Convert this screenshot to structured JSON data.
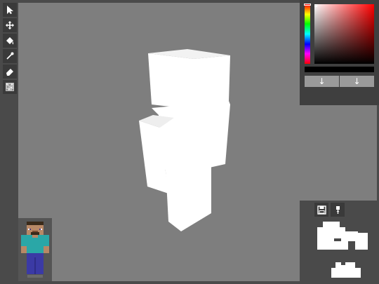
{
  "toolbar": {
    "tools": [
      {
        "name": "select",
        "icon": "cursor-arrow-icon"
      },
      {
        "name": "move",
        "icon": "move-arrows-icon"
      },
      {
        "name": "fill",
        "icon": "paint-bucket-icon"
      },
      {
        "name": "picker",
        "icon": "eyedropper-icon"
      },
      {
        "name": "eraser",
        "icon": "eraser-icon"
      },
      {
        "name": "noise",
        "icon": "noise-texture-icon"
      }
    ]
  },
  "color_picker": {
    "hue_color": "#ff0000",
    "current_color": "#000000",
    "swap_left_glyph": "↓",
    "swap_right_glyph": "↓"
  },
  "parts_panel": {
    "tabs": [
      {
        "name": "save",
        "icon": "save-disk-icon"
      },
      {
        "name": "export",
        "icon": "brush-upload-icon"
      }
    ]
  },
  "colors": {
    "background": "#4a4a4a",
    "viewport": "#7e7e7e",
    "model_white": "#ffffff",
    "skin_shirt": "#2aa7a7",
    "skin_pants": "#3b3aa5"
  }
}
